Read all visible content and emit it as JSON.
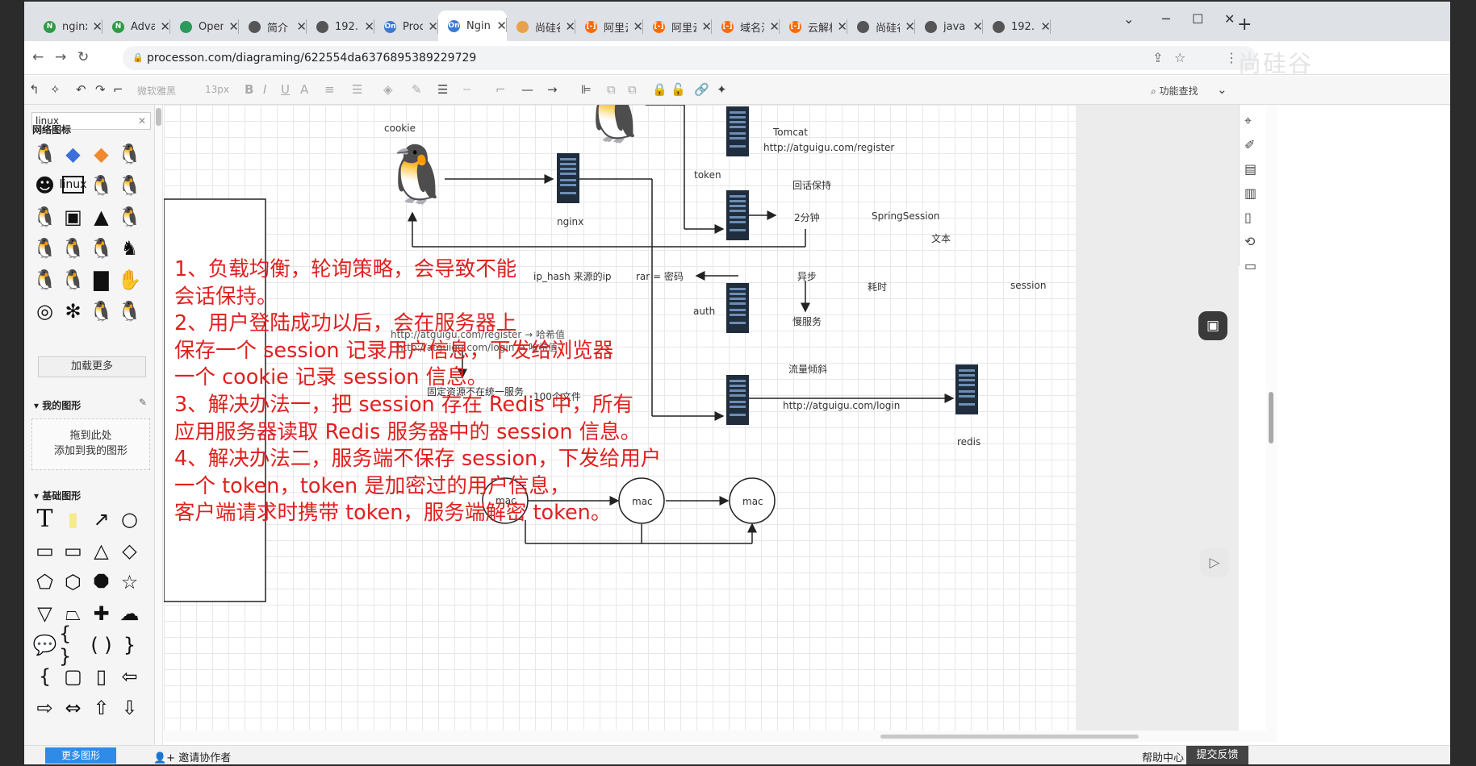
{
  "browser": {
    "tabs": [
      {
        "title": "nginx",
        "favicon": "N",
        "color": "#2e9a45"
      },
      {
        "title": "Adva",
        "favicon": "N",
        "color": "#2e9a45"
      },
      {
        "title": "Open",
        "favicon": "",
        "color": "#2b9a5a"
      },
      {
        "title": "简介",
        "favicon": "",
        "color": "#555"
      },
      {
        "title": "192.1",
        "favicon": "",
        "color": "#555"
      },
      {
        "title": "Proce",
        "favicon": "On",
        "color": "#3a78d6"
      },
      {
        "title": "Ngin",
        "favicon": "On",
        "color": "#3a78d6",
        "active": true
      },
      {
        "title": "尚硅谷",
        "favicon": "",
        "color": "#e8a14c"
      },
      {
        "title": "阿里云",
        "favicon": "[-]",
        "color": "#ff6a00"
      },
      {
        "title": "阿里云",
        "favicon": "[-]",
        "color": "#ff6a00"
      },
      {
        "title": "域名注",
        "favicon": "[-]",
        "color": "#ff6a00"
      },
      {
        "title": "云解析",
        "favicon": "[-]",
        "color": "#ff6a00"
      },
      {
        "title": "尚硅谷",
        "favicon": "",
        "color": "#555"
      },
      {
        "title": "java",
        "favicon": "",
        "color": "#555"
      },
      {
        "title": "192.1",
        "favicon": "",
        "color": "#555"
      }
    ],
    "url": "processon.com/diagraming/622554da6376895389229729",
    "watermark": "尚硅谷"
  },
  "toolbar": {
    "font": "微软雅黑",
    "font_size": "13px",
    "search_label": "功能查找"
  },
  "left_panel": {
    "search_value": "linux",
    "section_network": "网络图标",
    "load_more": "加载更多",
    "section_my": "▾ 我的图形",
    "drop_hint_1": "拖到此处",
    "drop_hint_2": "添加到我的图形",
    "section_basic": "▾ 基础图形"
  },
  "canvas": {
    "labels": {
      "cookie": "cookie",
      "nginx": "nginx",
      "token": "token",
      "tomcat": "Tomcat",
      "register_url": "http://atguigu.com/register",
      "session_keep": "回话保持",
      "two_min": "2分钟",
      "spring_session": "SpringSession",
      "text": "文本",
      "ip_hash": "ip_hash  来源的ip",
      "rar": "rar = 密码",
      "async": "异步",
      "time_cost": "耗时",
      "session": "session",
      "auth": "auth",
      "slow_service": "慢服务",
      "url_hash_1": "http://atguigu.com/register → 哈希值",
      "url_hash_2": "http://atguigu.com/login → 哈希值",
      "traffic_skew": "流量倾斜",
      "login_url": "http://atguigu.com/login",
      "static_res": "固定资源不在统一服务",
      "hundred_files": "100个文件",
      "redis": "redis",
      "mac1": "mac",
      "mac2": "mac",
      "mac3": "mac"
    },
    "notes": [
      "1、负载均衡，轮询策略，会导致不能",
      "会话保持。",
      "2、用户登陆成功以后，会在服务器上",
      "保存一个 session 记录用户信息，下发给浏览器",
      "一个 cookie 记录 session 信息。",
      "3、解决办法一，把 session 存在 Redis 中，所有",
      "应用服务器读取 Redis 服务器中的 session 信息。",
      "4、解决办法二，服务端不保存 session，下发给用户",
      "一个 token，token 是加密过的用户信息，",
      "客户端请求时携带 token，服务端解密 token。"
    ]
  },
  "status": {
    "more_shapes": "更多图形",
    "invite": "邀请协作者",
    "help": "帮助中心",
    "feedback": "提交反馈"
  }
}
